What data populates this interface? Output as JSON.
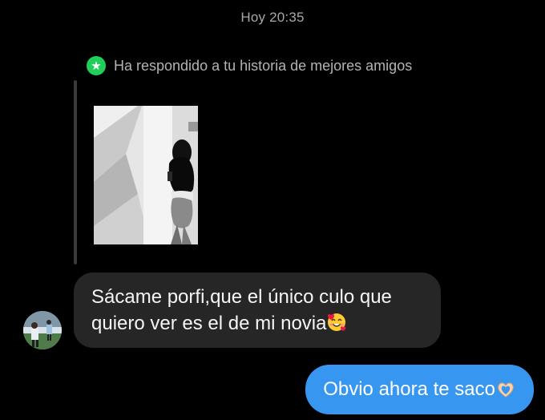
{
  "chat": {
    "timestamp": "Hoy 20:35",
    "story_reply_notice": "Ha respondido a tu historia de mejores amigos",
    "story_image_alt": "story photo",
    "incoming_message": "Sácame porfi,que el único culo que\nquiero ver es el de mi novia",
    "incoming_emoji": "smiling-face-with-hearts-emoji",
    "outgoing_message": "Obvio ahora te saco",
    "outgoing_emoji": "heart-hands-emoji"
  },
  "colors": {
    "background": "#000000",
    "incoming_bubble": "#262626",
    "outgoing_bubble": "#3797f0",
    "close_friends_green": "#1fce5b"
  }
}
